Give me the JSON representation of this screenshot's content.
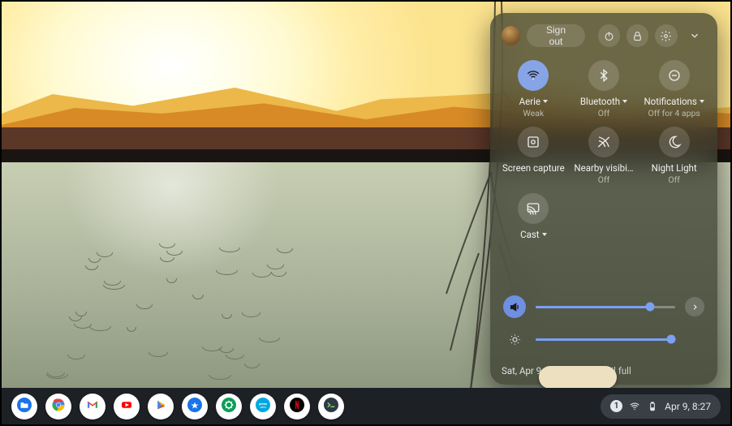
{
  "header": {
    "signout_label": "Sign out"
  },
  "tiles": [
    {
      "id": "wifi",
      "label": "Aerie",
      "status": "Weak",
      "on": true,
      "icon": "wifi",
      "dropdown": true
    },
    {
      "id": "bluetooth",
      "label": "Bluetooth",
      "status": "Off",
      "on": false,
      "icon": "bluetooth",
      "dropdown": true
    },
    {
      "id": "notifications",
      "label": "Notifications",
      "status": "Off for 4 apps",
      "on": false,
      "icon": "dnd",
      "dropdown": true
    },
    {
      "id": "capture",
      "label": "Screen capture",
      "status": "",
      "on": false,
      "icon": "capture",
      "dropdown": false
    },
    {
      "id": "nearby",
      "label": "Nearby visibi…",
      "status": "Off",
      "on": false,
      "icon": "nearby",
      "dropdown": false
    },
    {
      "id": "nightlight",
      "label": "Night Light",
      "status": "Off",
      "on": false,
      "icon": "nightlight",
      "dropdown": false
    },
    {
      "id": "cast",
      "label": "Cast",
      "status": "",
      "on": false,
      "icon": "cast",
      "dropdown": true
    }
  ],
  "sliders": {
    "volume_pct": 82,
    "brightness_pct": 97
  },
  "footer": {
    "date": "Sat, Apr 9",
    "battery": "4% - 1:52 until full"
  },
  "shelf": {
    "apps": [
      {
        "id": "files",
        "name": "files-icon"
      },
      {
        "id": "chrome",
        "name": "chrome-icon"
      },
      {
        "id": "gmail",
        "name": "gmail-icon"
      },
      {
        "id": "youtube",
        "name": "youtube-icon"
      },
      {
        "id": "play",
        "name": "play-store-icon"
      },
      {
        "id": "explore",
        "name": "explore-icon"
      },
      {
        "id": "extension",
        "name": "extension-icon"
      },
      {
        "id": "prime",
        "name": "prime-video-icon"
      },
      {
        "id": "netflix",
        "name": "netflix-icon"
      },
      {
        "id": "terminal",
        "name": "terminal-icon"
      }
    ]
  },
  "status": {
    "notif_count": "1",
    "clock": "Apr 9, 8:27"
  }
}
